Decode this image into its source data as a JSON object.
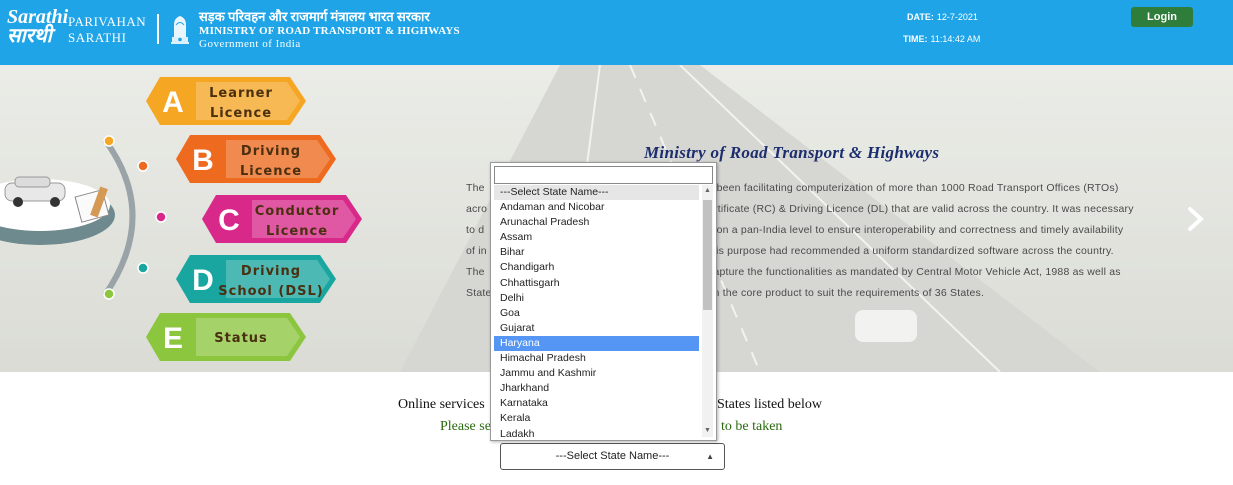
{
  "header": {
    "logo_line1": "Sarathi",
    "logo_line2": "सारथी",
    "parivahan": "PARIVAHAN",
    "sarathi": "SARATHI",
    "ministry_hindi": "सड़क परिवहन और राजमार्ग मंत्रालय भारत सरकार",
    "ministry_english": "MINISTRY OF ROAD TRANSPORT & HIGHWAYS",
    "government": "Government of India",
    "date_label": "DATE:",
    "date_value": "12-7-2021",
    "time_label": "TIME:",
    "time_value": "11:14:42 AM",
    "login_label": "Login"
  },
  "menu": [
    {
      "letter": "A",
      "line1": "Learner",
      "line2": "Licence",
      "color": "#f5a623"
    },
    {
      "letter": "B",
      "line1": "Driving",
      "line2": "Licence",
      "color": "#ee6a1e"
    },
    {
      "letter": "C",
      "line1": "Conductor",
      "line2": "Licence",
      "color": "#d8298a"
    },
    {
      "letter": "D",
      "line1": "Driving",
      "line2": "School (DSL)",
      "color": "#1aa6a0"
    },
    {
      "letter": "E",
      "line1": "Status",
      "line2": "",
      "color": "#8cc63f"
    }
  ],
  "banner": {
    "title": "Ministry of Road Transport & Highways",
    "desc_lines": [
      [
        "The",
        "s been facilitating computerization of more than 1000 Road Transport Offices (RTOs)"
      ],
      [
        "acro",
        "ertificate (RC) & Driving Licence (DL) that are valid across the country. It was necessary"
      ],
      [
        "to d",
        "s on a pan-India level to ensure interoperability and correctness and timely availability"
      ],
      [
        "of in",
        "his purpose had recommended a uniform standardized software across the country."
      ],
      [
        "The",
        "capture the functionalities as mandated by Central Motor Vehicle Act, 1988 as well as"
      ],
      [
        "State",
        "in the core product to suit the requirements of 36 States."
      ]
    ]
  },
  "main": {
    "online_left": "Online services",
    "online_right": "States listed below",
    "please_left": "Please se",
    "please_right": "to be taken"
  },
  "state_select": {
    "selected": "---Select State Name---",
    "highlighted": "Haryana",
    "options": [
      "---Select State Name---",
      "Andaman and Nicobar",
      "Arunachal Pradesh",
      "Assam",
      "Bihar",
      "Chandigarh",
      "Chhattisgarh",
      "Delhi",
      "Goa",
      "Gujarat",
      "Haryana",
      "Himachal Pradesh",
      "Jammu and Kashmir",
      "Jharkhand",
      "Karnataka",
      "Kerala",
      "Ladakh"
    ]
  },
  "colors": {
    "header_bg": "#1fa4e8",
    "login_bg": "#2e7d3a",
    "option_highlight": "#5596f4",
    "title_navy": "#1d2e6e",
    "please_green": "#2a6a10"
  }
}
